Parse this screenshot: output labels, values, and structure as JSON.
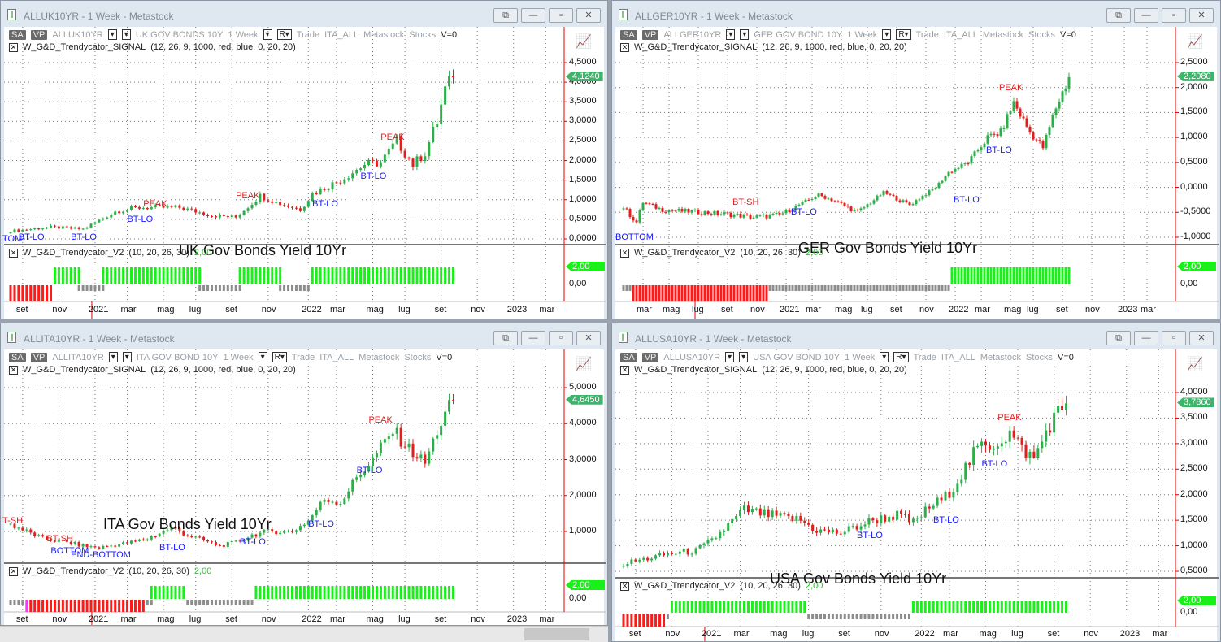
{
  "header_common": {
    "sa": "SA",
    "vp": "VP",
    "period": "1 Week",
    "r": "R▾",
    "trade": "Trade",
    "list": "ITA_ALL",
    "source": "Metastock",
    "type": "Stocks",
    "volume": "V=0",
    "signal_name": "W_G&D_Trendycator_SIGNAL",
    "signal_params": "(12, 26, 9, 1000, red, blue, 0, 20, 20)",
    "ind_name": "W_G&D_Trendycator_V2",
    "ind_params": "(10, 20, 26, 30)",
    "ind_value": "2,00",
    "ind_zero": "0,00"
  },
  "window_buttons": [
    "⧉",
    "—",
    "▫",
    "✕"
  ],
  "colors": {
    "up": "#2eae4a",
    "down": "#e0201c",
    "ind_up": "#19f019",
    "ind_flat": "#8c8c8c",
    "ind_down": "#ff1a1a",
    "ind_start": "#ff33ff",
    "last_tag": "#3cb56a",
    "axis": "#e00000"
  },
  "panes": [
    {
      "title": "ALLUK10YR - 1 Week - Metastock",
      "symbol": "ALLUK10YR",
      "desc": "UK GOV BONDS 10Y",
      "big_label": "UK Gov Bonds Yield 10Yr",
      "last_value": "4,1240",
      "chart_data": {
        "type": "candlestick",
        "weeks": 110,
        "y_ticks": [
          "0,0000",
          "0,5000",
          "1,0000",
          "1,5000",
          "2,0000",
          "2,5000",
          "3,0000",
          "3,5000",
          "4,0000",
          "4,5000"
        ],
        "y_tick_values": [
          0,
          0.5,
          1,
          1.5,
          2,
          2.5,
          3,
          3.5,
          4,
          4.5
        ],
        "last": 4.124,
        "anchors": [
          [
            0,
            0.2
          ],
          [
            10,
            0.3
          ],
          [
            18,
            0.25
          ],
          [
            26,
            0.7
          ],
          [
            32,
            0.8
          ],
          [
            42,
            0.8
          ],
          [
            50,
            0.6
          ],
          [
            56,
            0.55
          ],
          [
            62,
            1.1
          ],
          [
            67,
            0.9
          ],
          [
            72,
            0.75
          ],
          [
            75,
            1.15
          ],
          [
            82,
            1.5
          ],
          [
            88,
            1.9
          ],
          [
            92,
            1.95
          ],
          [
            96,
            2.5
          ],
          [
            100,
            1.9
          ],
          [
            103,
            2.2
          ],
          [
            106,
            3.0
          ],
          [
            108,
            3.8
          ],
          [
            110,
            4.12
          ]
        ],
        "months": [
          [
            "set",
            3
          ],
          [
            "nov",
            12
          ],
          [
            "2021",
            21
          ],
          [
            "mar",
            29
          ],
          [
            "mag",
            38
          ],
          [
            "lug",
            46
          ],
          [
            "set",
            55
          ],
          [
            "nov",
            64
          ],
          [
            "2022",
            74
          ],
          [
            "mar",
            81
          ],
          [
            "mag",
            90
          ],
          [
            "lug",
            98
          ],
          [
            "set",
            107
          ],
          [
            "nov",
            116
          ],
          [
            "2023",
            125
          ],
          [
            "mar",
            133
          ]
        ],
        "indicator": [
          [
            0,
            10,
            "down"
          ],
          [
            11,
            17,
            "up"
          ],
          [
            17,
            23,
            "flat"
          ],
          [
            23,
            47,
            "up"
          ],
          [
            47,
            57,
            "flat"
          ],
          [
            57,
            67,
            "up"
          ],
          [
            67,
            74,
            "flat"
          ],
          [
            75,
            110,
            "up"
          ]
        ],
        "annotations": [
          [
            "TOM",
            0,
            0.0,
            "blue"
          ],
          [
            "BT-LO",
            4,
            0.05,
            "blue"
          ],
          [
            "BT-LO",
            17,
            0.05,
            "blue"
          ],
          [
            "BT-LO",
            31,
            0.5,
            "blue"
          ],
          [
            "PEAK",
            35,
            0.9,
            "red"
          ],
          [
            "PEAK",
            58,
            1.1,
            "red"
          ],
          [
            "BT-LO",
            77,
            0.9,
            "blue"
          ],
          [
            "BT-LO",
            89,
            1.6,
            "blue"
          ],
          [
            "PEAK",
            94,
            2.6,
            "red"
          ]
        ]
      }
    },
    {
      "title": "ALLGER10YR - 1 Week - Metastock",
      "symbol": "ALLGER10YR",
      "desc": "GER GOV BOND 10Y",
      "big_label": "GER Gov Bonds Yield 10Yr",
      "last_value": "2,2080",
      "chart_data": {
        "type": "candlestick",
        "weeks": 137,
        "y_ticks": [
          "-1,0000",
          "-0,5000",
          "0,0000",
          "0,5000",
          "1,0000",
          "1,5000",
          "2,0000",
          "2,5000"
        ],
        "y_tick_values": [
          -1,
          -0.5,
          0,
          0.5,
          1,
          1.5,
          2,
          2.5
        ],
        "last": 2.208,
        "anchors": [
          [
            0,
            -0.4
          ],
          [
            4,
            -0.7
          ],
          [
            6,
            -0.3
          ],
          [
            12,
            -0.45
          ],
          [
            24,
            -0.5
          ],
          [
            34,
            -0.55
          ],
          [
            40,
            -0.6
          ],
          [
            48,
            -0.55
          ],
          [
            60,
            -0.15
          ],
          [
            66,
            -0.3
          ],
          [
            72,
            -0.5
          ],
          [
            80,
            -0.1
          ],
          [
            88,
            -0.35
          ],
          [
            96,
            0.0
          ],
          [
            100,
            0.3
          ],
          [
            106,
            0.5
          ],
          [
            112,
            1.0
          ],
          [
            116,
            1.1
          ],
          [
            120,
            1.7
          ],
          [
            125,
            1.1
          ],
          [
            129,
            0.8
          ],
          [
            133,
            1.6
          ],
          [
            137,
            2.2
          ]
        ],
        "months": [
          [
            "mar",
            6
          ],
          [
            "mag",
            14
          ],
          [
            "lug",
            23
          ],
          [
            "set",
            32
          ],
          [
            "nov",
            41
          ],
          [
            "2021",
            50
          ],
          [
            "mar",
            58
          ],
          [
            "mag",
            67
          ],
          [
            "lug",
            75
          ],
          [
            "set",
            84
          ],
          [
            "nov",
            93
          ],
          [
            "2022",
            102
          ],
          [
            "mar",
            110
          ],
          [
            "mag",
            119
          ],
          [
            "lug",
            126
          ],
          [
            "set",
            135
          ],
          [
            "nov",
            144
          ],
          [
            "2023",
            154
          ],
          [
            "mar",
            161
          ]
        ],
        "indicator": [
          [
            0,
            2,
            "flat"
          ],
          [
            3,
            44,
            "down"
          ],
          [
            45,
            72,
            "flat"
          ],
          [
            73,
            82,
            "flat"
          ],
          [
            83,
            91,
            "flat"
          ],
          [
            92,
            100,
            "flat"
          ],
          [
            101,
            137,
            "up"
          ]
        ],
        "annotations": [
          [
            "BOTTOM",
            0,
            -1.0,
            "blue"
          ],
          [
            "BT-SH",
            36,
            -0.3,
            "red"
          ],
          [
            "BT-LO",
            54,
            -0.5,
            "blue"
          ],
          [
            "BT-LO",
            104,
            -0.25,
            "blue"
          ],
          [
            "BT-LO",
            114,
            0.75,
            "blue"
          ],
          [
            "PEAK",
            118,
            2.0,
            "red"
          ]
        ]
      }
    },
    {
      "title": "ALLITA10YR - 1 Week - Metastock",
      "symbol": "ALLITA10YR",
      "desc": "ITA GOV BOND 10Y",
      "big_label": "ITA Gov Bonds Yield 10Yr",
      "last_value": "4,6450",
      "chart_data": {
        "type": "candlestick",
        "weeks": 110,
        "y_ticks": [
          "1,0000",
          "2,0000",
          "3,0000",
          "4,0000",
          "5,0000"
        ],
        "y_tick_values": [
          1,
          2,
          3,
          4,
          5
        ],
        "last": 4.645,
        "anchors": [
          [
            0,
            1.2
          ],
          [
            8,
            0.8
          ],
          [
            14,
            0.7
          ],
          [
            18,
            0.6
          ],
          [
            22,
            0.55
          ],
          [
            30,
            0.7
          ],
          [
            34,
            0.8
          ],
          [
            40,
            1.1
          ],
          [
            44,
            0.9
          ],
          [
            52,
            0.6
          ],
          [
            56,
            0.7
          ],
          [
            60,
            0.9
          ],
          [
            64,
            1.0
          ],
          [
            70,
            1.0
          ],
          [
            74,
            1.3
          ],
          [
            78,
            1.9
          ],
          [
            82,
            1.8
          ],
          [
            86,
            2.5
          ],
          [
            90,
            3.0
          ],
          [
            95,
            3.8
          ],
          [
            99,
            3.3
          ],
          [
            103,
            2.9
          ],
          [
            106,
            3.8
          ],
          [
            110,
            4.65
          ]
        ],
        "months": [
          [
            "set",
            3
          ],
          [
            "nov",
            12
          ],
          [
            "2021",
            21
          ],
          [
            "mar",
            29
          ],
          [
            "mag",
            38
          ],
          [
            "lug",
            46
          ],
          [
            "set",
            55
          ],
          [
            "nov",
            64
          ],
          [
            "2022",
            74
          ],
          [
            "mar",
            81
          ],
          [
            "mag",
            90
          ],
          [
            "lug",
            98
          ],
          [
            "set",
            107
          ],
          [
            "nov",
            116
          ],
          [
            "2023",
            125
          ],
          [
            "mar",
            133
          ]
        ],
        "indicator": [
          [
            0,
            3,
            "flat"
          ],
          [
            4,
            33,
            "down"
          ],
          [
            34,
            35,
            "flat"
          ],
          [
            35,
            43,
            "up"
          ],
          [
            44,
            56,
            "flat"
          ],
          [
            57,
            60,
            "flat"
          ],
          [
            61,
            110,
            "up"
          ]
        ],
        "annotations": [
          [
            "T-SH",
            0,
            1.3,
            "red"
          ],
          [
            "BT-SH",
            11,
            0.8,
            "red"
          ],
          [
            "BOTTOM",
            12,
            0.45,
            "blue"
          ],
          [
            "END-BOTTOM",
            17,
            0.35,
            "blue"
          ],
          [
            "BT-LO",
            39,
            0.55,
            "blue"
          ],
          [
            "BT-LO",
            59,
            0.7,
            "blue"
          ],
          [
            "BT-LO",
            76,
            1.2,
            "blue"
          ],
          [
            "BT-LO",
            88,
            2.7,
            "blue"
          ],
          [
            "PEAK",
            91,
            4.1,
            "red"
          ]
        ]
      }
    },
    {
      "title": "ALLUSA10YR - 1 Week - Metastock",
      "symbol": "ALLUSA10YR",
      "desc": "USA GOV BOND 10Y",
      "big_label": "USA Gov Bonds Yield 10Yr",
      "last_value": "3,7860",
      "chart_data": {
        "type": "candlestick",
        "weeks": 110,
        "y_ticks": [
          "0,5000",
          "1,0000",
          "1,5000",
          "2,0000",
          "2,5000",
          "3,0000",
          "3,5000",
          "4,0000"
        ],
        "y_tick_values": [
          0.5,
          1,
          1.5,
          2,
          2.5,
          3,
          3.5,
          4
        ],
        "last": 3.786,
        "anchors": [
          [
            0,
            0.65
          ],
          [
            12,
            0.85
          ],
          [
            18,
            0.9
          ],
          [
            22,
            1.1
          ],
          [
            26,
            1.4
          ],
          [
            30,
            1.7
          ],
          [
            36,
            1.6
          ],
          [
            44,
            1.5
          ],
          [
            48,
            1.3
          ],
          [
            54,
            1.25
          ],
          [
            62,
            1.5
          ],
          [
            68,
            1.6
          ],
          [
            72,
            1.45
          ],
          [
            76,
            1.75
          ],
          [
            80,
            1.95
          ],
          [
            84,
            2.4
          ],
          [
            88,
            2.9
          ],
          [
            92,
            3.0
          ],
          [
            96,
            3.2
          ],
          [
            99,
            2.9
          ],
          [
            102,
            2.7
          ],
          [
            106,
            3.4
          ],
          [
            110,
            3.79
          ]
        ],
        "months": [
          [
            "set",
            3
          ],
          [
            "nov",
            12
          ],
          [
            "2021",
            21
          ],
          [
            "mar",
            29
          ],
          [
            "mag",
            38
          ],
          [
            "lug",
            46
          ],
          [
            "set",
            55
          ],
          [
            "nov",
            64
          ],
          [
            "2022",
            74
          ],
          [
            "mar",
            81
          ],
          [
            "mag",
            90
          ],
          [
            "lug",
            98
          ],
          [
            "set",
            107
          ],
          [
            "nov",
            116
          ],
          [
            "2023",
            125
          ],
          [
            "mar",
            133
          ]
        ],
        "indicator": [
          [
            0,
            10,
            "down"
          ],
          [
            11,
            11,
            "flat"
          ],
          [
            12,
            45,
            "up"
          ],
          [
            46,
            55,
            "flat"
          ],
          [
            56,
            68,
            "flat"
          ],
          [
            69,
            71,
            "flat"
          ],
          [
            72,
            110,
            "up"
          ]
        ],
        "annotations": [
          [
            "BT-LO",
            60,
            1.2,
            "blue"
          ],
          [
            "BT-LO",
            79,
            1.5,
            "blue"
          ],
          [
            "BT-LO",
            91,
            2.6,
            "blue"
          ],
          [
            "PEAK",
            95,
            3.5,
            "red"
          ]
        ]
      }
    }
  ]
}
